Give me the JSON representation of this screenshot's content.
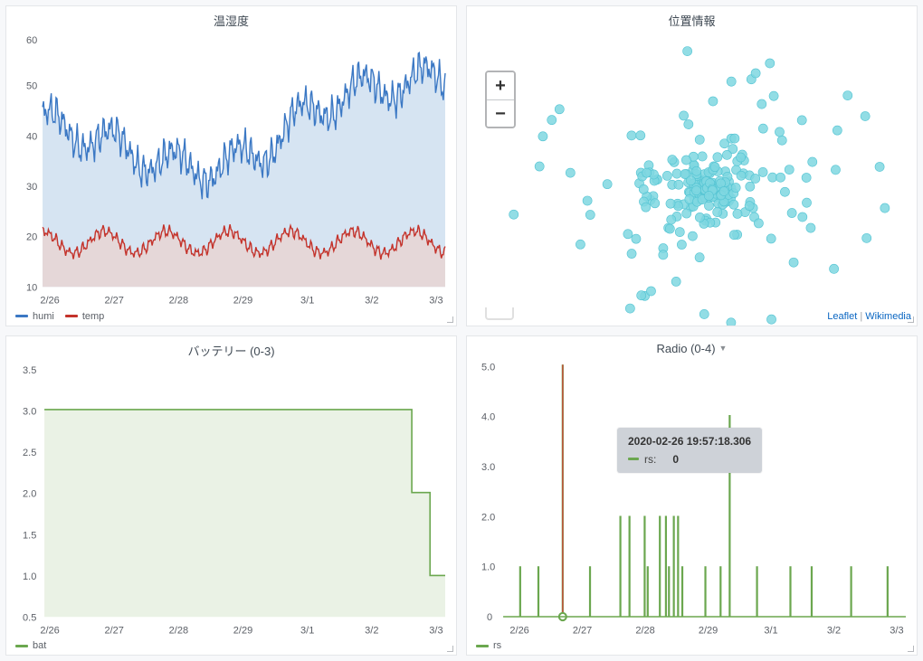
{
  "panels": {
    "temp_humi": {
      "title": "温湿度",
      "legend": {
        "humi": "humi",
        "temp": "temp"
      }
    },
    "location": {
      "title": "位置情報",
      "credits_leaflet": "Leaflet",
      "credits_sep": " | ",
      "credits_media": "Wikimedia"
    },
    "battery": {
      "title": "バッテリー (0-3)",
      "legend": {
        "bat": "bat"
      }
    },
    "radio": {
      "title": "Radio (0-4)",
      "legend": {
        "rs": "rs"
      },
      "tooltip": {
        "time": "2020-02-26 19:57:18.306",
        "series": "rs:",
        "value": "0"
      }
    }
  },
  "axis_dates": [
    "2/26",
    "2/27",
    "2/28",
    "2/29",
    "3/1",
    "3/2",
    "3/3"
  ],
  "zoom": {
    "in": "+",
    "out": "−"
  },
  "chart_data": [
    {
      "type": "area",
      "title": "温湿度",
      "xlabel": "",
      "ylabel": "",
      "ylim": [
        10,
        60
      ],
      "x": [
        0,
        1,
        2,
        3,
        4,
        5,
        6
      ],
      "x_labels": [
        "2/26",
        "2/27",
        "2/28",
        "2/29",
        "3/1",
        "3/2",
        "3/3"
      ],
      "series": [
        {
          "name": "humi",
          "color": "#3b78c4",
          "values": [
            44,
            46,
            43,
            37,
            33,
            38,
            45,
            52,
            48
          ]
        },
        {
          "name": "temp",
          "color": "#c4332b",
          "values": [
            22,
            18,
            18,
            19,
            20,
            21,
            19,
            19,
            18
          ]
        }
      ],
      "note": "high-frequency noisy timeseries; values above are visual envelope midpoints per day"
    },
    {
      "type": "scatter",
      "title": "位置情報",
      "xlabel": "",
      "ylabel": "",
      "note": "GPS point cloud centered mid-panel; ~200 cyan points clustered with sparse outliers",
      "approx_center": {
        "x": 0.55,
        "y": 0.5
      },
      "spread": 0.35
    },
    {
      "type": "line",
      "title": "バッテリー (0-3)",
      "ylim": [
        0.5,
        3.5
      ],
      "x_labels": [
        "2/26",
        "2/27",
        "2/28",
        "2/29",
        "3/1",
        "3/2",
        "3/3"
      ],
      "series": [
        {
          "name": "bat",
          "color": "#6ba74f",
          "step_values": [
            {
              "x": 0.0,
              "y": 3
            },
            {
              "x": 6.05,
              "y": 3
            },
            {
              "x": 6.05,
              "y": 2
            },
            {
              "x": 6.35,
              "y": 2
            },
            {
              "x": 6.35,
              "y": 1
            },
            {
              "x": 6.6,
              "y": 1
            }
          ]
        }
      ]
    },
    {
      "type": "bar",
      "title": "Radio (0-4)",
      "ylim": [
        0,
        5
      ],
      "x_labels": [
        "2/26",
        "2/27",
        "2/28",
        "2/29",
        "3/1",
        "3/2",
        "3/3"
      ],
      "series": [
        {
          "name": "rs",
          "color": "#6ba74f",
          "spikes": [
            {
              "x": 0.25,
              "y": 1
            },
            {
              "x": 0.55,
              "y": 1
            },
            {
              "x": 0.95,
              "y": 5
            },
            {
              "x": 1.4,
              "y": 1
            },
            {
              "x": 1.9,
              "y": 2
            },
            {
              "x": 2.05,
              "y": 2
            },
            {
              "x": 2.3,
              "y": 2
            },
            {
              "x": 2.35,
              "y": 1
            },
            {
              "x": 2.55,
              "y": 2
            },
            {
              "x": 2.65,
              "y": 2
            },
            {
              "x": 2.7,
              "y": 1
            },
            {
              "x": 2.78,
              "y": 2
            },
            {
              "x": 2.85,
              "y": 2
            },
            {
              "x": 2.92,
              "y": 1
            },
            {
              "x": 3.3,
              "y": 1
            },
            {
              "x": 3.55,
              "y": 1
            },
            {
              "x": 3.7,
              "y": 4
            },
            {
              "x": 4.15,
              "y": 1
            },
            {
              "x": 4.7,
              "y": 1
            },
            {
              "x": 5.05,
              "y": 1
            },
            {
              "x": 5.7,
              "y": 1
            },
            {
              "x": 6.3,
              "y": 1
            }
          ],
          "cursor_x": 0.95
        }
      ]
    }
  ]
}
